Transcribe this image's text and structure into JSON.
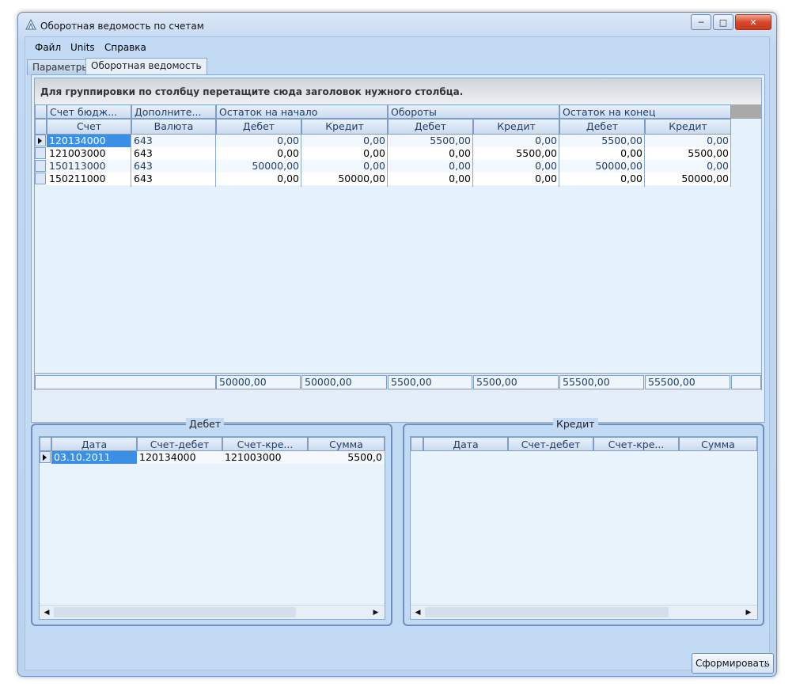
{
  "window": {
    "title": "Оборотная ведомость по счетам",
    "min_label": "─",
    "max_label": "□",
    "close_label": "✕"
  },
  "menu": {
    "items": [
      "Файл",
      "Units",
      "Справка"
    ]
  },
  "tabs": [
    {
      "label": "Параметры",
      "active": false
    },
    {
      "label": "Оборотная ведомость",
      "active": true
    }
  ],
  "grid": {
    "group_panel_text": "Для группировки по столбцу перетащите сюда заголовок нужного столбца.",
    "band_headers": [
      "Счет бюдж...",
      "Дополните...",
      "Остаток на начало",
      "Обороты",
      "Остаток на конец"
    ],
    "columns": [
      "Счет",
      "Валюта",
      "Дебет",
      "Кредит",
      "Дебет",
      "Кредит",
      "Дебет",
      "Кредит"
    ],
    "rows": [
      [
        "120134000",
        "643",
        "0,00",
        "0,00",
        "5500,00",
        "0,00",
        "5500,00",
        "0,00"
      ],
      [
        "121003000",
        "643",
        "0,00",
        "0,00",
        "0,00",
        "5500,00",
        "0,00",
        "5500,00"
      ],
      [
        "150113000",
        "643",
        "50000,00",
        "0,00",
        "0,00",
        "0,00",
        "50000,00",
        "0,00"
      ],
      [
        "150211000",
        "643",
        "0,00",
        "50000,00",
        "0,00",
        "0,00",
        "0,00",
        "50000,00"
      ]
    ],
    "totals": [
      "50000,00",
      "50000,00",
      "5500,00",
      "5500,00",
      "55500,00",
      "55500,00"
    ]
  },
  "debit_panel": {
    "title": "Дебет",
    "columns": [
      "Дата",
      "Счет-дебет",
      "Счет-кре...",
      "Сумма"
    ],
    "rows": [
      [
        "03.10.2011",
        "120134000",
        "121003000",
        "5500,0"
      ]
    ]
  },
  "credit_panel": {
    "title": "Кредит",
    "columns": [
      "Дата",
      "Счет-дебет",
      "Счет-кре...",
      "Сумма"
    ],
    "rows": []
  },
  "actions": {
    "generate_label": "Сформировать"
  },
  "colors": {
    "client_bg": "#c2daf4",
    "grid_header_text": "#1f3e6b",
    "selection": "#3b8fe4",
    "close_button": "#d9472b"
  }
}
